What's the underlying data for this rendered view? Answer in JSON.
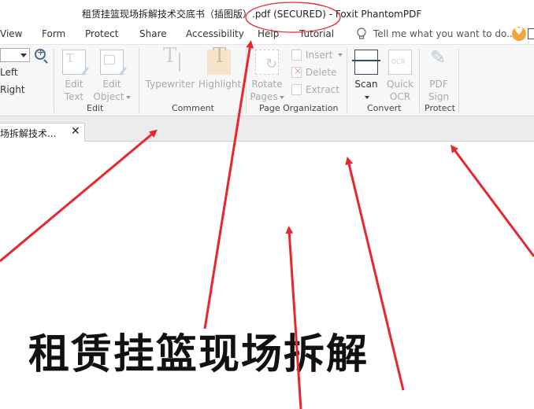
{
  "window": {
    "title": "租赁挂篮现场拆解技术交底书（插图版）.pdf (SECURED) - Foxit PhantomPDF"
  },
  "menu": {
    "items": [
      "View",
      "Form",
      "Protect",
      "Share",
      "Accessibility",
      "Help",
      "Tutorial"
    ],
    "tell_me": "Tell me what you want to do.."
  },
  "ribbon": {
    "view_group": {
      "rotate_left": "Left",
      "rotate_right": "Right"
    },
    "edit_group": {
      "label": "Edit",
      "edit_text": [
        "Edit",
        "Text"
      ],
      "edit_object": [
        "Edit",
        "Object"
      ]
    },
    "comment_group": {
      "label": "Comment",
      "typewriter": "Typewriter",
      "highlight": "Highlight"
    },
    "page_org_group": {
      "label": "Page Organization",
      "rotate_pages": [
        "Rotate",
        "Pages"
      ],
      "insert": "Insert",
      "delete": "Delete",
      "extract": "Extract"
    },
    "convert_group": {
      "label": "Convert",
      "scan": "Scan",
      "quick_ocr": [
        "Quick",
        "OCR"
      ]
    },
    "protect_group": {
      "label": "Protect",
      "pdf_sign": [
        "PDF",
        "Sign"
      ]
    }
  },
  "tabs": [
    {
      "label": "场拆解技术...",
      "active": true
    }
  ],
  "document": {
    "heading": "租赁挂篮现场拆解"
  },
  "colors": {
    "annotation_red": "#e8262b",
    "highlight_fill": "#f6e3c9",
    "heart_orange": "#f1a63b"
  }
}
